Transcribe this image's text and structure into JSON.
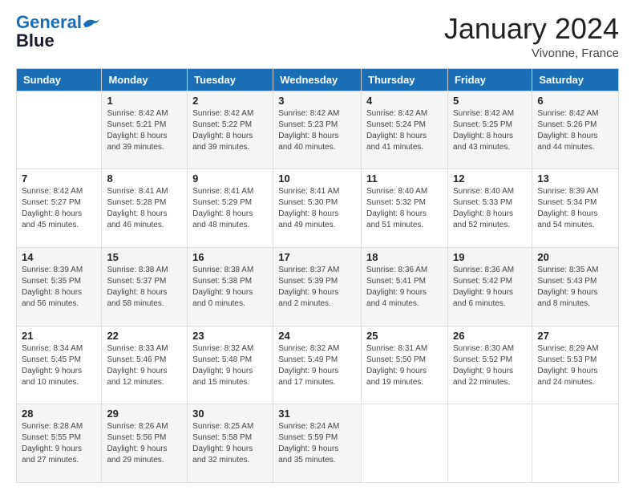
{
  "header": {
    "logo_line1": "General",
    "logo_line2": "Blue",
    "month_title": "January 2024",
    "location": "Vivonne, France"
  },
  "weekdays": [
    "Sunday",
    "Monday",
    "Tuesday",
    "Wednesday",
    "Thursday",
    "Friday",
    "Saturday"
  ],
  "weeks": [
    [
      {
        "day": "",
        "info": ""
      },
      {
        "day": "1",
        "info": "Sunrise: 8:42 AM\nSunset: 5:21 PM\nDaylight: 8 hours\nand 39 minutes."
      },
      {
        "day": "2",
        "info": "Sunrise: 8:42 AM\nSunset: 5:22 PM\nDaylight: 8 hours\nand 39 minutes."
      },
      {
        "day": "3",
        "info": "Sunrise: 8:42 AM\nSunset: 5:23 PM\nDaylight: 8 hours\nand 40 minutes."
      },
      {
        "day": "4",
        "info": "Sunrise: 8:42 AM\nSunset: 5:24 PM\nDaylight: 8 hours\nand 41 minutes."
      },
      {
        "day": "5",
        "info": "Sunrise: 8:42 AM\nSunset: 5:25 PM\nDaylight: 8 hours\nand 43 minutes."
      },
      {
        "day": "6",
        "info": "Sunrise: 8:42 AM\nSunset: 5:26 PM\nDaylight: 8 hours\nand 44 minutes."
      }
    ],
    [
      {
        "day": "7",
        "info": "Sunrise: 8:42 AM\nSunset: 5:27 PM\nDaylight: 8 hours\nand 45 minutes."
      },
      {
        "day": "8",
        "info": "Sunrise: 8:41 AM\nSunset: 5:28 PM\nDaylight: 8 hours\nand 46 minutes."
      },
      {
        "day": "9",
        "info": "Sunrise: 8:41 AM\nSunset: 5:29 PM\nDaylight: 8 hours\nand 48 minutes."
      },
      {
        "day": "10",
        "info": "Sunrise: 8:41 AM\nSunset: 5:30 PM\nDaylight: 8 hours\nand 49 minutes."
      },
      {
        "day": "11",
        "info": "Sunrise: 8:40 AM\nSunset: 5:32 PM\nDaylight: 8 hours\nand 51 minutes."
      },
      {
        "day": "12",
        "info": "Sunrise: 8:40 AM\nSunset: 5:33 PM\nDaylight: 8 hours\nand 52 minutes."
      },
      {
        "day": "13",
        "info": "Sunrise: 8:39 AM\nSunset: 5:34 PM\nDaylight: 8 hours\nand 54 minutes."
      }
    ],
    [
      {
        "day": "14",
        "info": "Sunrise: 8:39 AM\nSunset: 5:35 PM\nDaylight: 8 hours\nand 56 minutes."
      },
      {
        "day": "15",
        "info": "Sunrise: 8:38 AM\nSunset: 5:37 PM\nDaylight: 8 hours\nand 58 minutes."
      },
      {
        "day": "16",
        "info": "Sunrise: 8:38 AM\nSunset: 5:38 PM\nDaylight: 9 hours\nand 0 minutes."
      },
      {
        "day": "17",
        "info": "Sunrise: 8:37 AM\nSunset: 5:39 PM\nDaylight: 9 hours\nand 2 minutes."
      },
      {
        "day": "18",
        "info": "Sunrise: 8:36 AM\nSunset: 5:41 PM\nDaylight: 9 hours\nand 4 minutes."
      },
      {
        "day": "19",
        "info": "Sunrise: 8:36 AM\nSunset: 5:42 PM\nDaylight: 9 hours\nand 6 minutes."
      },
      {
        "day": "20",
        "info": "Sunrise: 8:35 AM\nSunset: 5:43 PM\nDaylight: 9 hours\nand 8 minutes."
      }
    ],
    [
      {
        "day": "21",
        "info": "Sunrise: 8:34 AM\nSunset: 5:45 PM\nDaylight: 9 hours\nand 10 minutes."
      },
      {
        "day": "22",
        "info": "Sunrise: 8:33 AM\nSunset: 5:46 PM\nDaylight: 9 hours\nand 12 minutes."
      },
      {
        "day": "23",
        "info": "Sunrise: 8:32 AM\nSunset: 5:48 PM\nDaylight: 9 hours\nand 15 minutes."
      },
      {
        "day": "24",
        "info": "Sunrise: 8:32 AM\nSunset: 5:49 PM\nDaylight: 9 hours\nand 17 minutes."
      },
      {
        "day": "25",
        "info": "Sunrise: 8:31 AM\nSunset: 5:50 PM\nDaylight: 9 hours\nand 19 minutes."
      },
      {
        "day": "26",
        "info": "Sunrise: 8:30 AM\nSunset: 5:52 PM\nDaylight: 9 hours\nand 22 minutes."
      },
      {
        "day": "27",
        "info": "Sunrise: 8:29 AM\nSunset: 5:53 PM\nDaylight: 9 hours\nand 24 minutes."
      }
    ],
    [
      {
        "day": "28",
        "info": "Sunrise: 8:28 AM\nSunset: 5:55 PM\nDaylight: 9 hours\nand 27 minutes."
      },
      {
        "day": "29",
        "info": "Sunrise: 8:26 AM\nSunset: 5:56 PM\nDaylight: 9 hours\nand 29 minutes."
      },
      {
        "day": "30",
        "info": "Sunrise: 8:25 AM\nSunset: 5:58 PM\nDaylight: 9 hours\nand 32 minutes."
      },
      {
        "day": "31",
        "info": "Sunrise: 8:24 AM\nSunset: 5:59 PM\nDaylight: 9 hours\nand 35 minutes."
      },
      {
        "day": "",
        "info": ""
      },
      {
        "day": "",
        "info": ""
      },
      {
        "day": "",
        "info": ""
      }
    ]
  ]
}
